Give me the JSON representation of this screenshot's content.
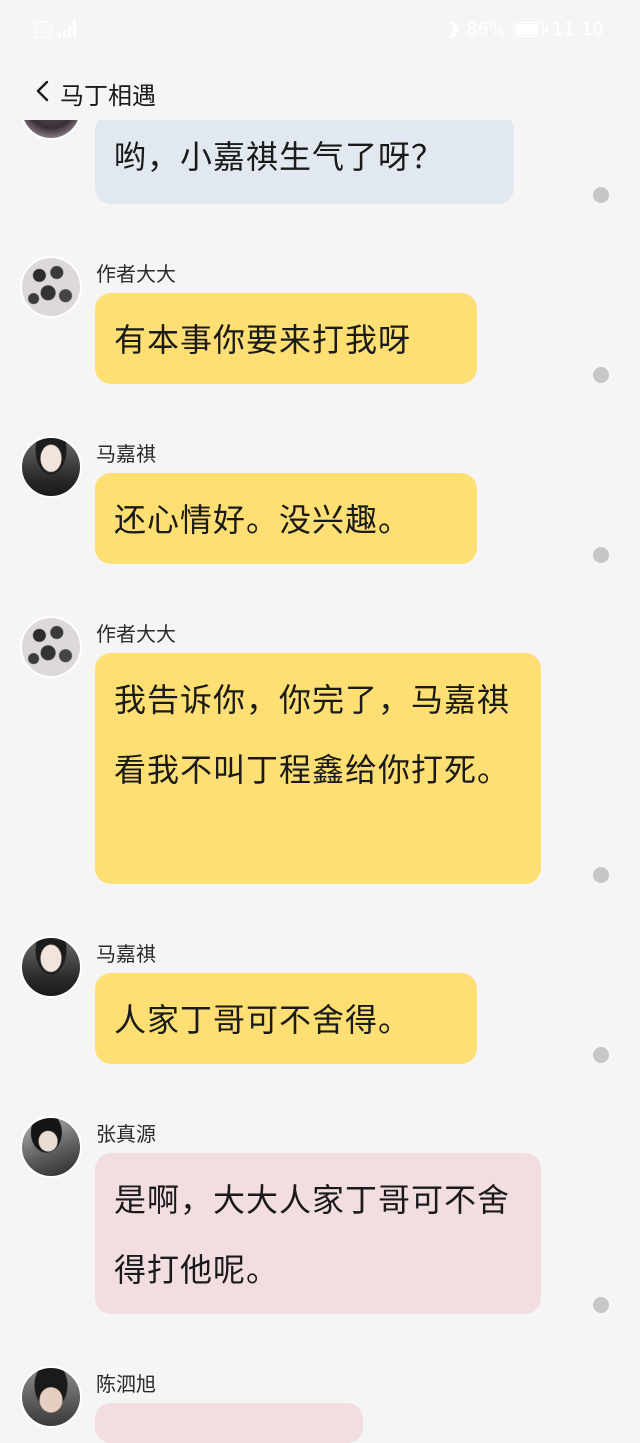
{
  "status_bar": {
    "hd_label": "HD",
    "battery_percent_label": "86%",
    "battery_level": 0.86,
    "time": "11:10"
  },
  "title_bar": {
    "title": "马丁相遇"
  },
  "messages": [
    {
      "sender": "",
      "text": "哟，小嘉祺生气了呀？",
      "style": "blue",
      "avatar": "dark-avatar"
    },
    {
      "sender": "作者大大",
      "text": "有本事你要来打我呀",
      "style": "yellow",
      "avatar": "collage-avatar"
    },
    {
      "sender": "马嘉祺",
      "text": "还心情好。没兴趣。",
      "style": "yellow",
      "avatar": "portrait-avatar"
    },
    {
      "sender": "作者大大",
      "text": "我告诉你，你完了，马嘉祺看我不叫丁程鑫给你打死。",
      "style": "yellow",
      "avatar": "collage-avatar"
    },
    {
      "sender": "马嘉祺",
      "text": "人家丁哥可不舍得。",
      "style": "yellow",
      "avatar": "portrait-avatar"
    },
    {
      "sender": "张真源",
      "text": "是啊，大大人家丁哥可不舍得打他呢。",
      "style": "pink",
      "avatar": "portrait-avatar"
    },
    {
      "sender": "陈泗旭",
      "text": "",
      "style": "pink",
      "avatar": "portrait-avatar"
    }
  ],
  "colors": {
    "bubble_yellow": "#fddf73",
    "bubble_blue": "#e2e8ef",
    "bubble_pink": "#f2dde0",
    "background": "#f5f5f5",
    "read_dot": "#c6c6c6"
  }
}
